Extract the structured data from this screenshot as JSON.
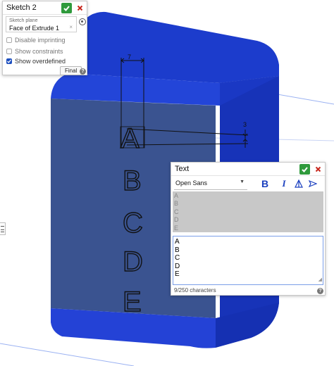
{
  "sketch_panel": {
    "title": "Sketch 2",
    "plane_label": "Sketch plane",
    "plane_value": "Face of Extrude 1",
    "options": [
      {
        "label": "Disable imprinting",
        "checked": false
      },
      {
        "label": "Show constraints",
        "checked": false
      },
      {
        "label": "Show overdefined",
        "checked": true
      }
    ],
    "final_label": "Final"
  },
  "text_panel": {
    "title": "Text",
    "font": "Open Sans",
    "preview_lines": [
      "A",
      "B",
      "C",
      "D",
      "E"
    ],
    "edit_lines": [
      "A",
      "B",
      "C",
      "D",
      "E"
    ],
    "char_count": "9/250 characters"
  },
  "dimensions": {
    "width": "7",
    "height": "3"
  },
  "model_letters": [
    "A",
    "B",
    "C",
    "D",
    "E"
  ],
  "colors": {
    "body_blue": "#1f3fd0",
    "face_slate": "#3a5390",
    "accept_green": "#2f9a3c",
    "cancel_red": "#c8281e"
  },
  "icons": [
    "check-icon",
    "close-icon",
    "plane-select-icon",
    "bold-icon",
    "italic-icon",
    "text-align-icon",
    "send-icon",
    "help-icon",
    "list-handle-icon"
  ]
}
